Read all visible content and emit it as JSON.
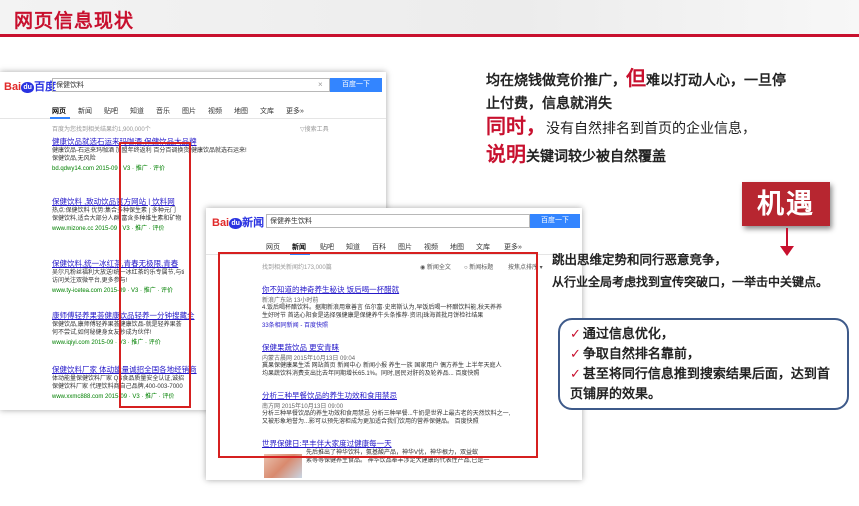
{
  "header": {
    "title": "网页信息现状"
  },
  "shot1": {
    "logo_left": "Bai",
    "logo_paw": "du",
    "logo_right": "百度",
    "query": "保健饮料",
    "button": "百度一下",
    "tabs": [
      "网页",
      "新闻",
      "贴吧",
      "知道",
      "音乐",
      "图片",
      "视频",
      "地图",
      "文库",
      "更多»"
    ],
    "result_count": "百度为您找到相关结果约1,900,000个",
    "toolbar": "▽搜索工具",
    "results": [
      {
        "title": "健康饮品就选石运来玛咖酒,保健饮品大品牌",
        "desc": "健康饮品-石运来玛咖酒 加盟年终返利 百分百调换货 健康饮品就选石运来!",
        "desc2": "保健饮品,无风险",
        "url": "bd.qdwy14.com  2015-09 · V3 · 推广 · 评价"
      },
      {
        "title": "保健饮料 ,致动饮品官方网站 | 饮料网",
        "desc": "热点:保健饮料 优势:集合多种保生素 | 多种元门",
        "desc2": "保健饮料,适合大部分人群,富含多种维生素和矿物",
        "url": "www.mizone.cc  2015-09 · V3 · 推广 · 评价"
      },
      {
        "title": "保健饮料,统一冰红茶,青春无极限,青春",
        "desc": "吴尔凡粉丝福利大放送!统一冰红茶约乐专属节,与ti",
        "desc2": "访问关注双微平台,更多参与!",
        "url": "www.ty-icetea.com  2015-09 · V3 · 推广 · 评价"
      },
      {
        "title": "康师傅轻养果荟健康饮品轻养一分钟搜藏全",
        "desc": "保健饮品,康师傅轻养果荟健康饮品-就是轻养果荟",
        "desc2": "何不尝试,如何秘健身女友秒成为伙伴!",
        "url": "www.iqiyi.com  2015-09 · V3 · 推广 · 评价"
      },
      {
        "title": "保健饮料厂家 体动能量诚招全国各地经销商",
        "desc": "体动能量保健饮料厂家 QS食品质量安全认证,诚招",
        "desc2": "保健饮料厂家 代理饮料商自己品牌,400-003-7000",
        "url": "www.xxmc888.com  2015-09 · V3 · 推广 · 评价"
      }
    ]
  },
  "shot2": {
    "logo_left": "Bai",
    "logo_paw": "du",
    "logo_right": "新闻",
    "query": "保健养生饮料",
    "button": "百度一下",
    "tabs": [
      "网页",
      "新闻",
      "贴吧",
      "知道",
      "百科",
      "图片",
      "视频",
      "地图",
      "文库",
      "更多»"
    ],
    "result_count": "找到相关新闻约173,000篇",
    "opt1": "◉ 新闻全文",
    "opt2": "○ 新闻标题",
    "sort": "按焦点排序 ▾",
    "results": [
      {
        "title": "你不知道的神奇养生秘诀 饭后喝一杯醋就",
        "source": "新浪广东站  13小时前",
        "desc": "4.饭后喝杯醋饮料。据期新浪用章善言 伍尔富·史密斯认为,早饭后喝一杯醋饮料能,秋天养养",
        "desc2": "生好时节 首选心阳食是选择强健康是保健养牛头条推荐·资讯|珠海首批月饼检社结果",
        "more": "33条相同新闻 - 百度快照"
      },
      {
        "title": "保健果蔬饮品 更安青睐",
        "source": "内蒙古晨网  2015年10月13日 09:04",
        "desc": "冀果保健康果生活 网站首页 新闻中心 新闻小报 养生一族 国家用户 偶方养生 上半年天庭人",
        "desc2": "均果蔬饮料消费支出比去年同期增长65.1%。同时,居民对肝的及轮养品...  百度快照",
        "more": ""
      },
      {
        "title": "分析三种早餐饮品的养生功效和食用禁忌",
        "source": "南方网  2015年10月13日 09:00",
        "desc": "分析三种早餐饮品的养生功效和食用禁忌 分析三种早餐...牛奶是世界上最古老的天然饮料之一,",
        "desc2": "又被形象地誉为...影可以预先溶柜成为更加适合我们饮用的营养保健品。  百度快照",
        "more": ""
      },
      {
        "title": "世界保健日:早丰伴大家度过健康每一天",
        "source": "",
        "desc": "先后推出了神华饮料，氨基酸产品，神华V优，神华根力，双益蚁",
        "desc2": "素等等保健养生食品。 神华饮品奉丰涉足大建康的代表性产品,已是一",
        "more": ""
      }
    ]
  },
  "right": {
    "line1a": "均在",
    "line1b": "烧钱做竞价推广",
    "line1c": "，",
    "line1d": "但",
    "line1e": "难以打动人心，一旦停",
    "line2": "止付费，信息就消失",
    "line3a": "同时",
    "line3b": "，",
    "line3c": "没有自然排名到首页的企业信息，",
    "line4a": "说明",
    "line4b": "关键词较少被自然覆盖",
    "opportunity": "机遇",
    "desc1": "跳出思维定势和同行恶意竞争，",
    "desc2": "从行业全局考虑找到宣传突破口，一举击中关键点。",
    "check": "✓",
    "points": [
      "通过信息优化，",
      "争取自然排名靠前，",
      "甚至将同行信息推到搜索结果后面，达到首",
      "页铺屏的效果。"
    ]
  },
  "colors": {
    "brand_red": "#c8102e",
    "baidu_blue": "#3385ff",
    "link_blue": "#2519c9",
    "panel_border": "#3e5a8a"
  }
}
